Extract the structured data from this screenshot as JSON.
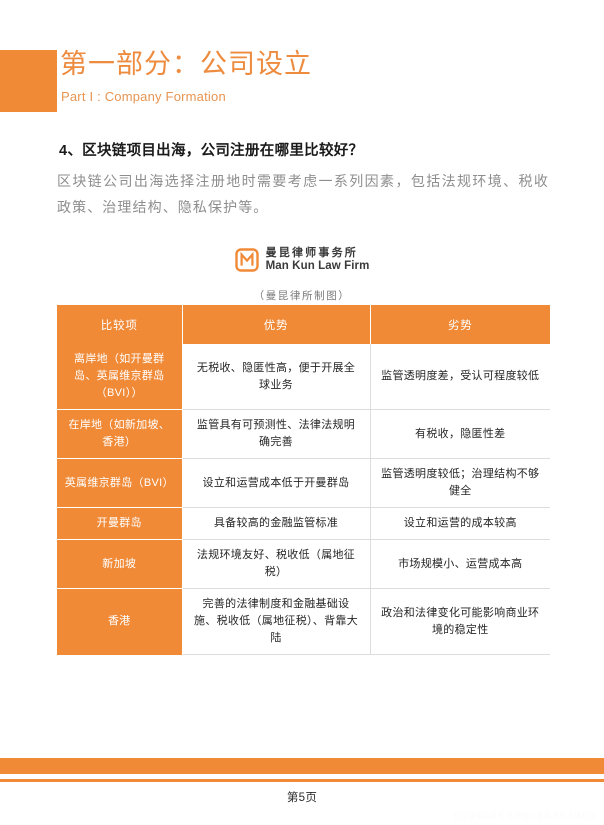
{
  "colors": {
    "accent": "#F08A37",
    "title_text": "#ED8B3F",
    "body_text": "#8e8e8e",
    "heading_text": "#1a1a1a",
    "table_border": "#dddddd"
  },
  "section": {
    "title_zh": "第一部分：公司设立",
    "title_en": "Part I : Company Formation"
  },
  "question": {
    "heading": "4、区块链项目出海，公司注册在哪里比较好？",
    "body": "区块链公司出海选择注册地时需要考虑一系列因素，包括法规环境、税收政策、治理结构、隐私保护等。"
  },
  "logo": {
    "mark_icon": "man-kun-m-logo-icon",
    "name_zh": "曼昆律师事务所",
    "name_en": "Man Kun Law Firm",
    "caption": "（曼昆律所制图）"
  },
  "table": {
    "headers": [
      "比较项",
      "优势",
      "劣势"
    ],
    "rows": [
      {
        "item": "离岸地（如开曼群岛、英属维京群岛（BVI））",
        "pros": "无税收、隐匿性高，便于开展全球业务",
        "cons": "监管透明度差，受认可程度较低"
      },
      {
        "item": "在岸地（如新加坡、香港）",
        "pros": "监管具有可预测性、法律法规明确完善",
        "cons": "有税收，隐匿性差"
      },
      {
        "item": "英属维京群岛（BVI）",
        "pros": "设立和运营成本低于开曼群岛",
        "cons": "监管透明度较低；治理结构不够健全"
      },
      {
        "item": "开曼群岛",
        "pros": "具备较高的金融监管标准",
        "cons": "设立和运营的成本较高"
      },
      {
        "item": "新加坡",
        "pros": "法规环境友好、税收低（属地征税）",
        "cons": "市场规模小、运营成本高"
      },
      {
        "item": "香港",
        "pros": "完善的法律制度和金融基础设施、税收低（属地征税）、背靠大陆",
        "cons": "政治和法律变化可能影响商业环境的稳定性"
      }
    ]
  },
  "footer": {
    "page_label": "第5页",
    "watermark": "曼昆律师事务所 区块链与虚拟货币法律服务"
  }
}
